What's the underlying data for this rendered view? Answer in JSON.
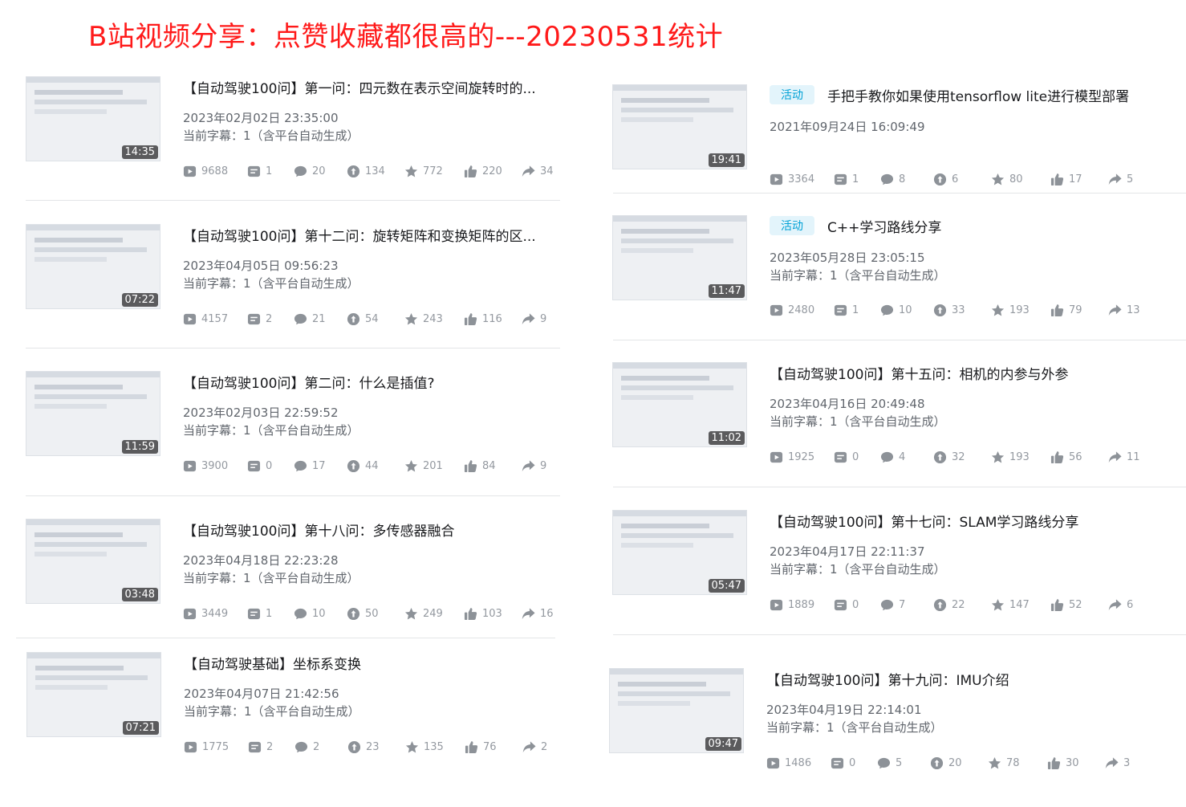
{
  "page_title": "B站视频分享：点赞收藏都很高的---20230531统计",
  "videos": [
    {
      "title": "【自动驾驶100问】第一问：四元数在表示空间旋转时的...",
      "tag": "",
      "date": "2023年02月02日 23:35:00",
      "subtitle": "当前字幕：1（含平台自动生成）",
      "duration": "14:35",
      "stats": {
        "views": "9688",
        "danmaku": "1",
        "comments": "20",
        "coins": "134",
        "favorites": "772",
        "likes": "220",
        "shares": "34"
      }
    },
    {
      "title": "【自动驾驶100问】第十二问：旋转矩阵和变换矩阵的区...",
      "tag": "",
      "date": "2023年04月05日 09:56:23",
      "subtitle": "当前字幕：1（含平台自动生成）",
      "duration": "07:22",
      "stats": {
        "views": "4157",
        "danmaku": "2",
        "comments": "21",
        "coins": "54",
        "favorites": "243",
        "likes": "116",
        "shares": "9"
      }
    },
    {
      "title": "【自动驾驶100问】第二问：什么是插值?",
      "tag": "",
      "date": "2023年02月03日 22:59:52",
      "subtitle": "当前字幕：1（含平台自动生成）",
      "duration": "11:59",
      "stats": {
        "views": "3900",
        "danmaku": "0",
        "comments": "17",
        "coins": "44",
        "favorites": "201",
        "likes": "84",
        "shares": "9"
      }
    },
    {
      "title": "【自动驾驶100问】第十八问：多传感器融合",
      "tag": "",
      "date": "2023年04月18日 22:23:28",
      "subtitle": "当前字幕：1（含平台自动生成）",
      "duration": "03:48",
      "stats": {
        "views": "3449",
        "danmaku": "1",
        "comments": "10",
        "coins": "50",
        "favorites": "249",
        "likes": "103",
        "shares": "16"
      }
    },
    {
      "title": "【自动驾驶基础】坐标系变换",
      "tag": "",
      "date": "2023年04月07日 21:42:56",
      "subtitle": "当前字幕：1（含平台自动生成）",
      "duration": "07:21",
      "stats": {
        "views": "1775",
        "danmaku": "2",
        "comments": "2",
        "coins": "23",
        "favorites": "135",
        "likes": "76",
        "shares": "2"
      }
    },
    {
      "title": "手把手教你如果使用tensorflow lite进行模型部署",
      "tag": "活动",
      "date": "2021年09月24日 16:09:49",
      "subtitle": "",
      "duration": "19:41",
      "stats": {
        "views": "3364",
        "danmaku": "1",
        "comments": "8",
        "coins": "6",
        "favorites": "80",
        "likes": "17",
        "shares": "5"
      }
    },
    {
      "title": "C++学习路线分享",
      "tag": "活动",
      "date": "2023年05月28日 23:05:15",
      "subtitle": "当前字幕：1（含平台自动生成）",
      "duration": "11:47",
      "stats": {
        "views": "2480",
        "danmaku": "1",
        "comments": "10",
        "coins": "33",
        "favorites": "193",
        "likes": "79",
        "shares": "13"
      }
    },
    {
      "title": "【自动驾驶100问】第十五问：相机的内参与外参",
      "tag": "",
      "date": "2023年04月16日 20:49:48",
      "subtitle": "当前字幕：1（含平台自动生成）",
      "duration": "11:02",
      "stats": {
        "views": "1925",
        "danmaku": "0",
        "comments": "4",
        "coins": "32",
        "favorites": "193",
        "likes": "56",
        "shares": "11"
      }
    },
    {
      "title": "【自动驾驶100问】第十七问：SLAM学习路线分享",
      "tag": "",
      "date": "2023年04月17日 22:11:37",
      "subtitle": "当前字幕：1（含平台自动生成）",
      "duration": "05:47",
      "stats": {
        "views": "1889",
        "danmaku": "0",
        "comments": "7",
        "coins": "22",
        "favorites": "147",
        "likes": "52",
        "shares": "6"
      }
    },
    {
      "title": "【自动驾驶100问】第十九问：IMU介绍",
      "tag": "",
      "date": "2023年04月19日 22:14:01",
      "subtitle": "当前字幕：1（含平台自动生成）",
      "duration": "09:47",
      "stats": {
        "views": "1486",
        "danmaku": "0",
        "comments": "5",
        "coins": "20",
        "favorites": "78",
        "likes": "30",
        "shares": "3"
      }
    }
  ],
  "icons": {
    "views": "play-icon",
    "danmaku": "danmaku-icon",
    "comments": "comment-icon",
    "coins": "coin-icon",
    "favorites": "star-icon",
    "likes": "thumbs-up-icon",
    "shares": "share-icon"
  },
  "colors": {
    "title": "#ff1a1a",
    "tag_text": "#00a1d6",
    "tag_bg": "#e3f4fb",
    "stat": "#9499a0"
  }
}
